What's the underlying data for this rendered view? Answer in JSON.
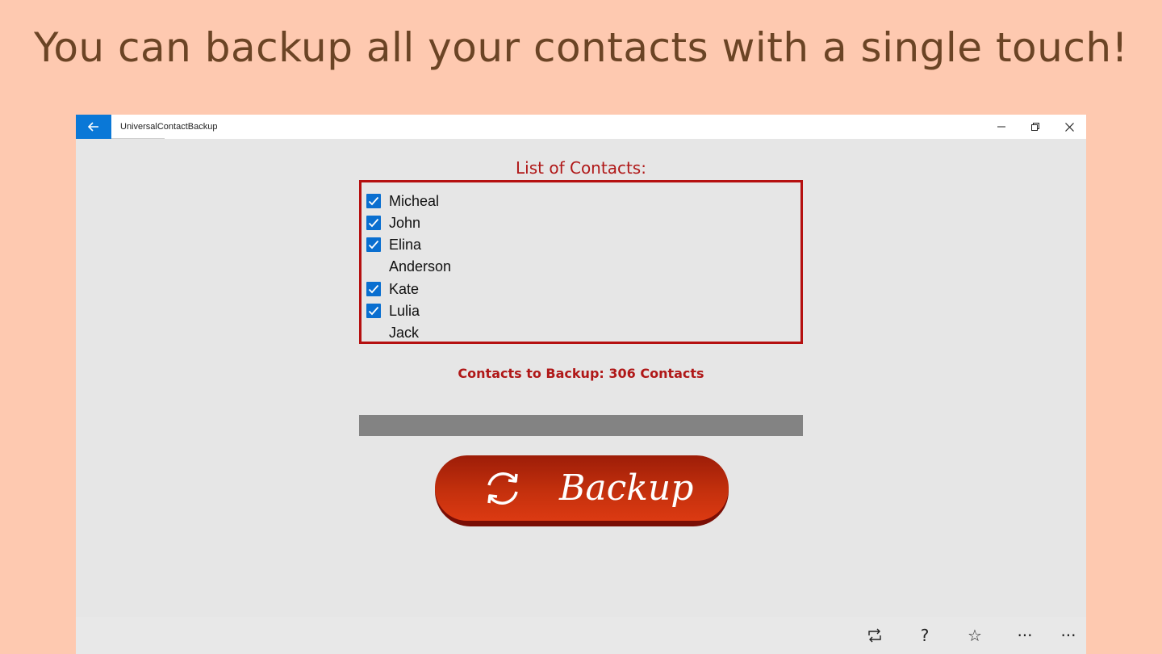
{
  "headline": "You can backup all your contacts with a single touch!",
  "window": {
    "title": "UniversalContactBackup",
    "back_icon": "arrow-left-icon",
    "controls": [
      "minimize-icon",
      "restore-icon",
      "close-icon"
    ]
  },
  "contacts": {
    "heading": "List of Contacts:",
    "items": [
      {
        "name": "Micheal",
        "checked": true
      },
      {
        "name": "John",
        "checked": true
      },
      {
        "name": "Elina",
        "checked": true
      },
      {
        "name": "Anderson",
        "checked": false
      },
      {
        "name": "Kate",
        "checked": true
      },
      {
        "name": "Lulia",
        "checked": true
      },
      {
        "name": "Jack",
        "checked": false
      }
    ]
  },
  "backup_count_text": "Contacts to Backup: 306 Contacts",
  "progress": {
    "fraction": 0.0
  },
  "backup_button": {
    "label": "Backup",
    "icon": "sync-icon"
  },
  "app_bar": {
    "buttons": [
      {
        "icon": "repeat-icon",
        "glyph": ""
      },
      {
        "icon": "help-icon",
        "glyph": "?"
      },
      {
        "icon": "star-icon",
        "glyph": "☆"
      },
      {
        "icon": "more-icon",
        "glyph": "···"
      },
      {
        "icon": "overflow-icon",
        "glyph": "···"
      }
    ]
  },
  "colors": {
    "background": "#fec9b0",
    "accent": "#0a78d7",
    "heading_red": "#b01818",
    "button_red": "#c4300d"
  }
}
